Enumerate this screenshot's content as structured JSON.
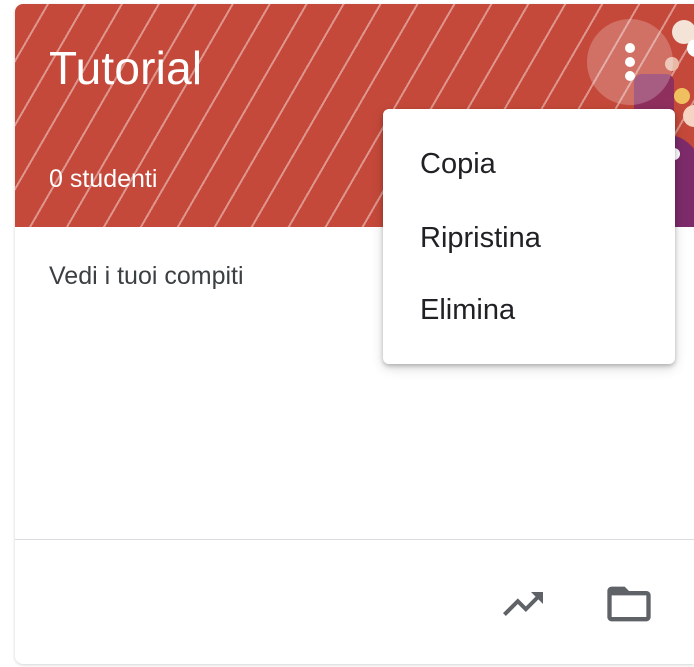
{
  "card": {
    "title": "Tutorial",
    "student_count": "0 studenti",
    "body_text": "Vedi i tuoi compiti",
    "header_color": "#c5493a",
    "more_icon": "more-vert-icon"
  },
  "footer": {
    "icons": [
      "trending-up-icon",
      "folder-icon"
    ]
  },
  "menu": {
    "items": [
      {
        "label": "Copia"
      },
      {
        "label": "Ripristina"
      },
      {
        "label": "Elimina"
      }
    ]
  },
  "colors": {
    "text_primary": "#202124",
    "text_secondary": "#3c4043",
    "icon": "#5f6368",
    "divider": "#dadce0"
  }
}
